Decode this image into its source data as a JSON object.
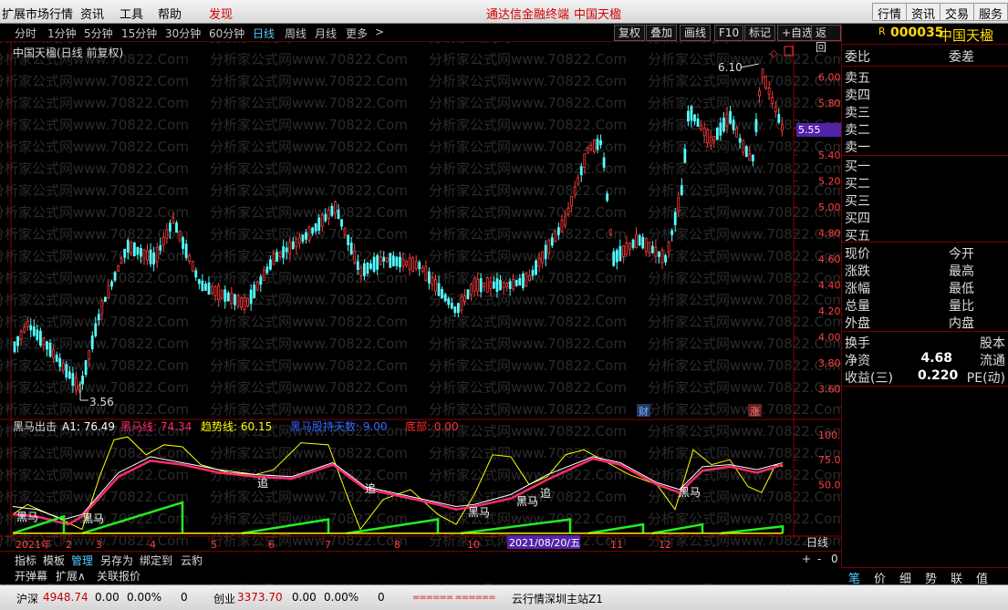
{
  "menu": {
    "left_items": [
      "扩展市场行情",
      "资讯",
      "工具",
      "帮助"
    ],
    "discover": "发现",
    "center_title": "通达信金融终端",
    "center_stock": "中国天楹",
    "right_buttons": [
      "行情",
      "资讯",
      "交易",
      "服务"
    ]
  },
  "periods": [
    "分时",
    "1分钟",
    "5分钟",
    "15分钟",
    "30分钟",
    "60分钟",
    "日线",
    "周线",
    "月线",
    "更多",
    ">"
  ],
  "active_period": "日线",
  "toolbar": [
    "复权",
    "叠加",
    "画线",
    "F10",
    "标记",
    "+自选",
    "返回"
  ],
  "chart_title": "中国天楹(日线 前复权)",
  "stock": {
    "code": "000035",
    "name": "中国天楹",
    "flag": "R"
  },
  "price_axis": [
    "6.00",
    "5.80",
    "5.60",
    "5.40",
    "5.20",
    "5.00",
    "4.80",
    "4.60",
    "4.40",
    "4.20",
    "4.00",
    "3.80",
    "3.60"
  ],
  "current_price_label": "5.55",
  "annotations": {
    "high": "6.10",
    "low": "3.56",
    "cai": "财",
    "zhang": "涨"
  },
  "indicator": {
    "name": "黑马出击",
    "a1": "A1: 76.49",
    "hm": "黑马线: 74.34",
    "trend": "趋势线: 60.15",
    "sj": "黑马股持天数: 9.00",
    "bottom": "底部: 0.00",
    "axis": [
      "100.0",
      "75.00",
      "50.00"
    ],
    "labels": [
      "黑马",
      "黑马",
      "追",
      "追",
      "黑马",
      "黑马",
      "追",
      "黑马"
    ],
    "colors": {
      "a1": "#ffffff",
      "hm": "#ff2a6d",
      "trend": "#ffff00",
      "sj": "#2255ff",
      "bottom": "#ff3030"
    }
  },
  "date_axis": [
    "2021年",
    "2",
    "3",
    "4",
    "5",
    "6",
    "7",
    "8",
    "10",
    "11",
    "12"
  ],
  "date_cursor": "2021/08/20/五",
  "period_label": "日线",
  "zoom": [
    "+",
    "-",
    "0"
  ],
  "bottom_tabs": [
    "指标",
    "模板",
    "管理",
    "另存为",
    "绑定到",
    "云豹"
  ],
  "active_tab": "管理",
  "bottom_row2": [
    "开弹幕",
    "扩展∧",
    "关联报价"
  ],
  "right_panel": {
    "weibi": "委比",
    "weicha": "委差",
    "sells": [
      "卖五",
      "卖四",
      "卖三",
      "卖二",
      "卖一"
    ],
    "buys": [
      "买一",
      "买二",
      "买三",
      "买四",
      "买五"
    ],
    "quote": [
      {
        "l": "现价",
        "r": "今开"
      },
      {
        "l": "涨跌",
        "r": "最高"
      },
      {
        "l": "涨幅",
        "r": "最低"
      },
      {
        "l": "总量",
        "r": "量比"
      },
      {
        "l": "外盘",
        "r": "内盘"
      }
    ],
    "info": [
      {
        "l": "换手",
        "v": "",
        "r": "股本"
      },
      {
        "l": "净资",
        "v": "4.68",
        "r": "流通"
      },
      {
        "l": "收益(三)",
        "v": "0.220",
        "r": "PE(动)"
      }
    ],
    "bottom_tabs": [
      "笔",
      "价",
      "细",
      "势",
      "联",
      "值"
    ]
  },
  "status": {
    "sh_label": "沪深",
    "sh_value": "4948.74",
    "sh_chg": "0.00",
    "sh_pct": "0.00%",
    "sh_vol": "0",
    "cy_label": "创业",
    "cy_value": "3373.70",
    "cy_chg": "0.00",
    "cy_pct": "0.00%",
    "cy_vol": "0",
    "server": "云行情深圳主站Z1"
  },
  "watermark": "分析家公式网www.70822.Com",
  "chart_data": {
    "type": "candlestick",
    "title": "中国天楹(日线 前复权)",
    "ylim": [
      3.5,
      6.2
    ],
    "y_ticks": [
      6.0,
      5.8,
      5.6,
      5.4,
      5.2,
      5.0,
      4.8,
      4.6,
      4.4,
      4.2,
      4.0,
      3.8,
      3.6
    ],
    "high_point": 6.1,
    "low_point": 3.56,
    "last_price": 5.55,
    "indicator_ylim": [
      0,
      110
    ]
  }
}
